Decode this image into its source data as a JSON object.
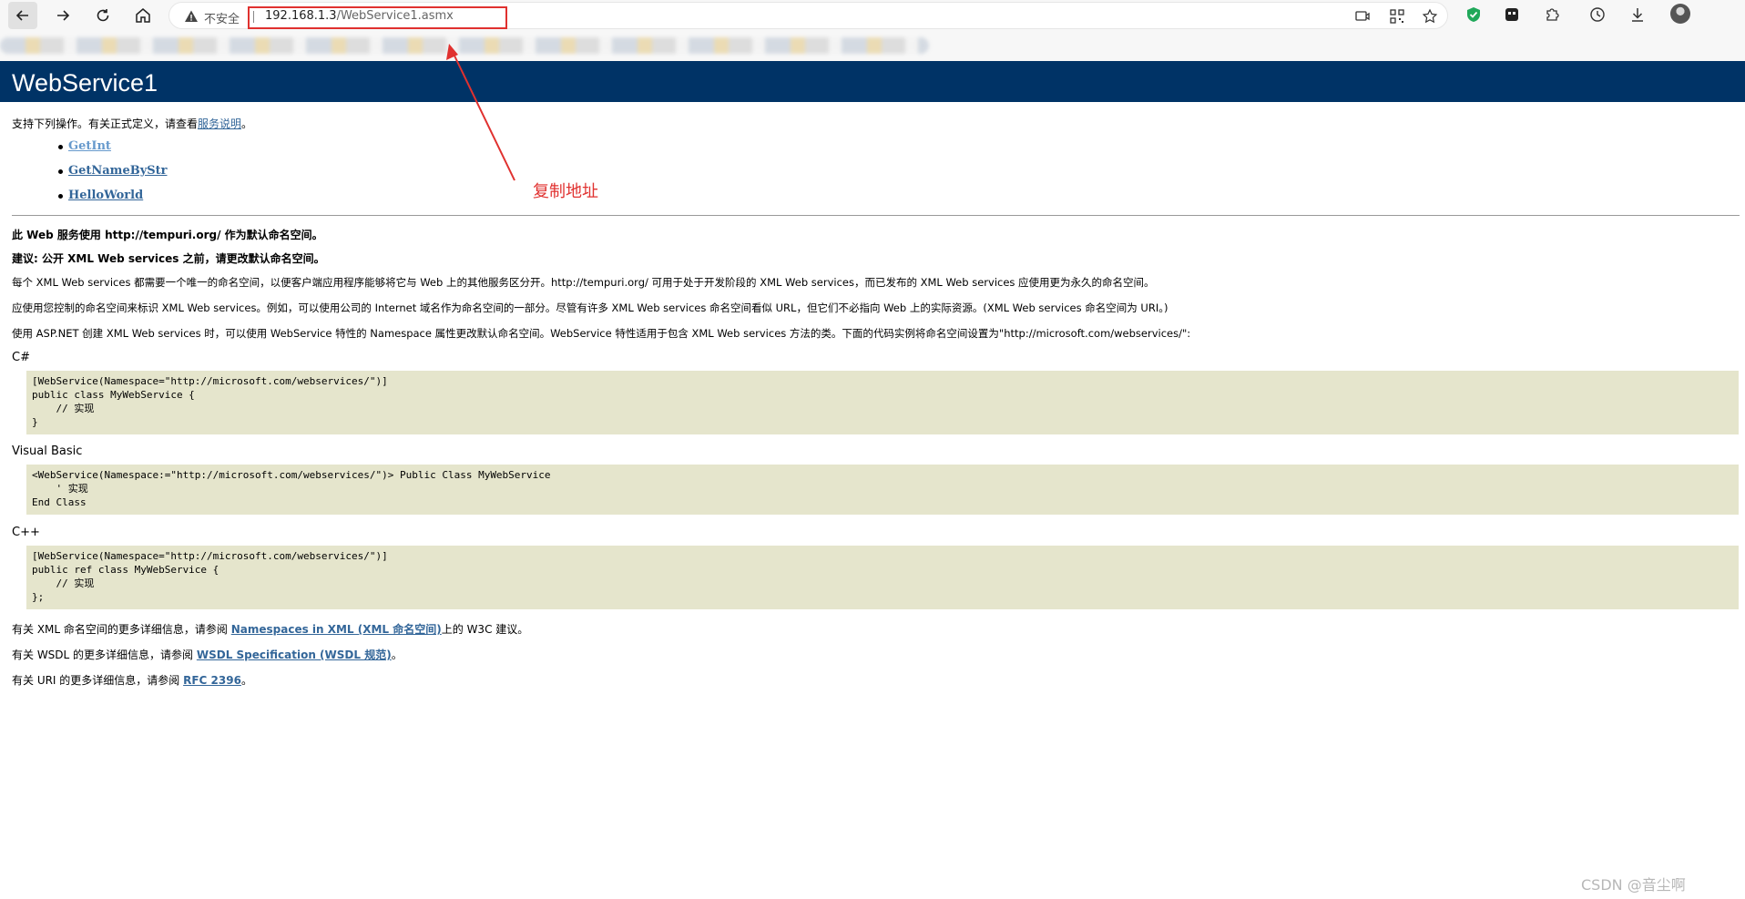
{
  "browser": {
    "insecure_label": "不安全",
    "url_host": "192.168.1.3",
    "url_path": "/WebService1.asmx",
    "icons": [
      "back-icon",
      "forward-icon",
      "reload-icon",
      "home-icon",
      "warning-icon",
      "read-aloud-icon",
      "qr-code-icon",
      "favorite-icon",
      "shield-extension-icon",
      "extension-icon",
      "puzzle-icon",
      "history-icon",
      "download-icon",
      "profile-avatar"
    ]
  },
  "page": {
    "title": "WebService1",
    "intro_prefix": "支持下列操作。有关正式定义，请查看",
    "intro_link": "服务说明",
    "intro_suffix": "。",
    "operations": [
      "GetInt",
      "GetNameByStr",
      "HelloWorld"
    ],
    "ns_line1": "此 Web 服务使用 http://tempuri.org/ 作为默认命名空间。",
    "ns_line2": "建议: 公开 XML Web services 之前，请更改默认命名空间。",
    "para1": "每个 XML Web services 都需要一个唯一的命名空间，以便客户端应用程序能够将它与 Web 上的其他服务区分开。http://tempuri.org/ 可用于处于开发阶段的 XML Web services，而已发布的 XML Web services 应使用更为永久的命名空间。",
    "para2": "应使用您控制的命名空间来标识 XML Web services。例如，可以使用公司的 Internet 域名作为命名空间的一部分。尽管有许多 XML Web services 命名空间看似 URL，但它们不必指向 Web 上的实际资源。(XML Web services 命名空间为 URI。)",
    "para3": "使用 ASP.NET 创建 XML Web services 时，可以使用 WebService 特性的 Namespace 属性更改默认命名空间。WebService 特性适用于包含 XML Web services 方法的类。下面的代码实例将命名空间设置为\"http://microsoft.com/webservices/\":",
    "samples": [
      {
        "lang": "C#",
        "code": "[WebService(Namespace=\"http://microsoft.com/webservices/\")]\npublic class MyWebService {\n    // 实现\n}"
      },
      {
        "lang": "Visual Basic",
        "code": "<WebService(Namespace:=\"http://microsoft.com/webservices/\")> Public Class MyWebService\n    ' 实现\nEnd Class"
      },
      {
        "lang": "C++",
        "code": "[WebService(Namespace=\"http://microsoft.com/webservices/\")]\npublic ref class MyWebService {\n    // 实现\n};"
      }
    ],
    "more_xml_prefix": "有关 XML 命名空间的更多详细信息，请参阅 ",
    "more_xml_link": "Namespaces in XML (XML 命名空间)",
    "more_xml_suffix": "上的 W3C 建议。",
    "more_wsdl_prefix": "有关 WSDL 的更多详细信息，请参阅 ",
    "more_wsdl_link": "WSDL Specification (WSDL 规范)",
    "more_wsdl_suffix": "。",
    "more_uri_prefix": "有关 URI 的更多详细信息，请参阅 ",
    "more_uri_link": "RFC 2396",
    "more_uri_suffix": "。"
  },
  "annotation": {
    "label": "复制地址",
    "color": "#e0312f"
  },
  "watermark": "CSDN @音尘啊",
  "colors": {
    "header_bg": "#003366",
    "code_bg": "#e5e5cc",
    "link": "#336699"
  }
}
